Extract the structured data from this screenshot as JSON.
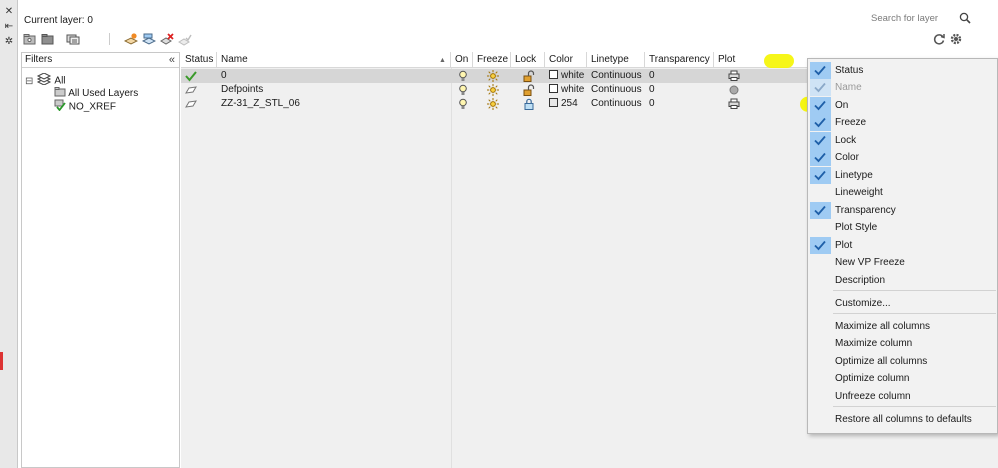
{
  "window": {
    "strip_buttons": [
      {
        "name": "close-icon",
        "glyph": "✕"
      },
      {
        "name": "auto-hide-icon",
        "glyph": "⇤"
      },
      {
        "name": "properties-icon",
        "glyph": "✲"
      }
    ]
  },
  "header": {
    "current_layer_label": "Current layer: 0",
    "search_placeholder": "Search for layer"
  },
  "toolbar": {
    "buttons": [
      "new-property-filter-icon",
      "new-group-filter-icon",
      "layer-states-manager-icon",
      "new-layer-icon",
      "new-layer-vp-frozen-icon",
      "delete-layer-icon",
      "set-current-icon"
    ],
    "refresh_icon": "refresh-icon",
    "settings_icon": "settings-icon"
  },
  "filters": {
    "title": "Filters",
    "collapse_glyph": "«",
    "tree": [
      {
        "label": "All",
        "expander": "⊟"
      },
      {
        "label": "All Used Layers"
      },
      {
        "label": "NO_XREF"
      }
    ]
  },
  "columns": [
    "Status",
    "Name",
    "On",
    "Freeze",
    "Lock",
    "Color",
    "Linetype",
    "Transparency",
    "Plot"
  ],
  "layers": [
    {
      "status": "current",
      "name": "0",
      "on": true,
      "freeze": false,
      "lock": "unlocked",
      "color": "white",
      "linetype": "Continuous",
      "transparency": "0",
      "plot": "printer",
      "selected": true
    },
    {
      "status": "layer",
      "name": "Defpoints",
      "on": true,
      "freeze": false,
      "lock": "unlocked",
      "color": "white",
      "linetype": "Continuous",
      "transparency": "0",
      "plot": "no-plot",
      "selected": false
    },
    {
      "status": "layer",
      "name": "ZZ-31_Z_STL_06",
      "on": true,
      "freeze": false,
      "lock": "locked",
      "color": "254",
      "linetype": "Continuous",
      "transparency": "0",
      "plot": "printer",
      "selected": false
    }
  ],
  "context_menu": {
    "items": [
      {
        "label": "Status",
        "checked": true
      },
      {
        "label": "Name",
        "checked": true,
        "disabled": true
      },
      {
        "label": "On",
        "checked": true,
        "highlighted": true
      },
      {
        "label": "Freeze",
        "checked": true
      },
      {
        "label": "Lock",
        "checked": true
      },
      {
        "label": "Color",
        "checked": true
      },
      {
        "label": "Linetype",
        "checked": true
      },
      {
        "label": "Lineweight",
        "checked": false
      },
      {
        "label": "Transparency",
        "checked": true
      },
      {
        "label": "Plot Style",
        "checked": false
      },
      {
        "label": "Plot",
        "checked": true
      },
      {
        "label": "New VP Freeze",
        "checked": false
      },
      {
        "label": "Description",
        "checked": false
      },
      {
        "label": "Customize...",
        "separator_before": true
      },
      {
        "label": "Maximize all columns",
        "separator_before": true
      },
      {
        "label": "Maximize column"
      },
      {
        "label": "Optimize all columns"
      },
      {
        "label": "Optimize column"
      },
      {
        "label": "Unfreeze column"
      },
      {
        "label": "Restore all columns to defaults",
        "separator_before": true
      }
    ]
  },
  "colors": {
    "highlight_marker": "#f5f500",
    "menu_check_bg": "#9fcbf3",
    "selected_row": "#d6d6d6",
    "status_check": "#3a9a2a"
  }
}
